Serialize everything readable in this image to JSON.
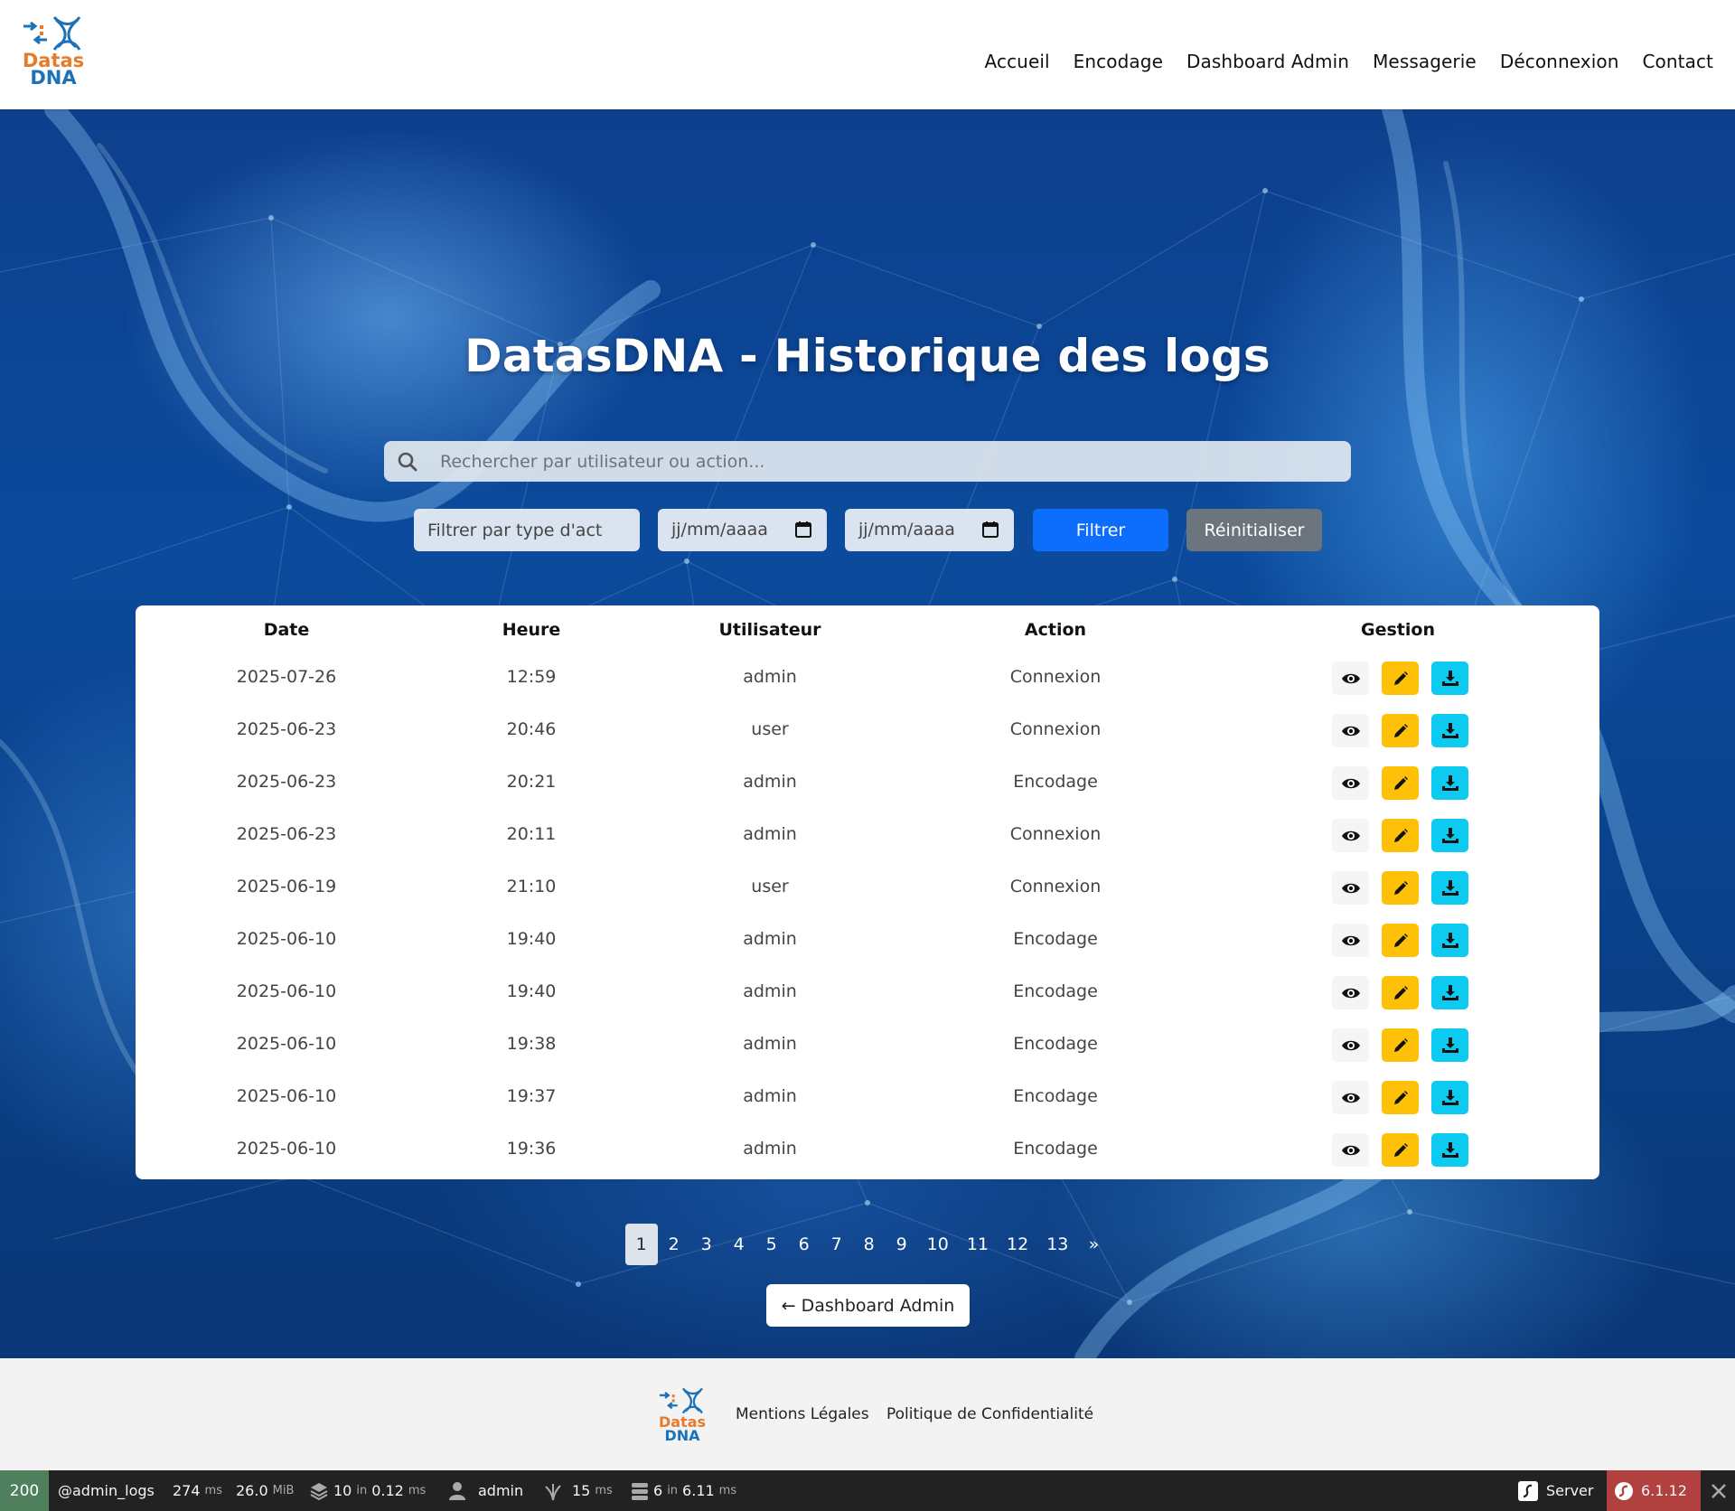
{
  "brand": {
    "line1": "Datas",
    "line2": "DNA"
  },
  "nav": [
    "Accueil",
    "Encodage",
    "Dashboard Admin",
    "Messagerie",
    "Déconnexion",
    "Contact"
  ],
  "hero": {
    "title": "DatasDNA - Historique des logs",
    "search_placeholder": "Rechercher par utilisateur ou action...",
    "filter_type_placeholder": "Filtrer par type d'act",
    "date_from": "jj/mm/aaaa",
    "date_to": "jj/mm/aaaa",
    "filter_label": "Filtrer",
    "reset_label": "Réinitialiser"
  },
  "table": {
    "headers": [
      "Date",
      "Heure",
      "Utilisateur",
      "Action",
      "Gestion"
    ],
    "rows": [
      [
        "2025-07-26",
        "12:59",
        "admin",
        "Connexion"
      ],
      [
        "2025-06-23",
        "20:46",
        "user",
        "Connexion"
      ],
      [
        "2025-06-23",
        "20:21",
        "admin",
        "Encodage"
      ],
      [
        "2025-06-23",
        "20:11",
        "admin",
        "Connexion"
      ],
      [
        "2025-06-19",
        "21:10",
        "user",
        "Connexion"
      ],
      [
        "2025-06-10",
        "19:40",
        "admin",
        "Encodage"
      ],
      [
        "2025-06-10",
        "19:40",
        "admin",
        "Encodage"
      ],
      [
        "2025-06-10",
        "19:38",
        "admin",
        "Encodage"
      ],
      [
        "2025-06-10",
        "19:37",
        "admin",
        "Encodage"
      ],
      [
        "2025-06-10",
        "19:36",
        "admin",
        "Encodage"
      ]
    ],
    "action_icons": [
      "eye-icon",
      "pencil-icon",
      "download-icon"
    ]
  },
  "pagination": {
    "pages": [
      "1",
      "2",
      "3",
      "4",
      "5",
      "6",
      "7",
      "8",
      "9",
      "10",
      "11",
      "12",
      "13"
    ],
    "next": "»",
    "current": "1"
  },
  "back_label": "← Dashboard Admin",
  "footer": {
    "links": [
      "Mentions Légales",
      "Politique de Confidentialité"
    ]
  },
  "debugbar": {
    "status": "200",
    "route": "@admin_logs",
    "time_value": "274",
    "time_unit": "ms",
    "memory_value": "26.0",
    "memory_unit": "MiB",
    "cache_count": "10",
    "cache_in": "in",
    "cache_time": "0.12",
    "cache_unit": "ms",
    "user": "admin",
    "twig_time": "15",
    "twig_unit": "ms",
    "db_count": "6",
    "db_in": "in",
    "db_time": "6.11",
    "db_unit": "ms",
    "server_label": "Server",
    "version": "6.1.12"
  },
  "colors": {
    "primary": "#0d6efd",
    "secondary": "#6c757d",
    "warning": "#ffc107",
    "info": "#0dcaf0",
    "brand_orange": "#e87b2b",
    "brand_blue": "#1b72b8"
  }
}
